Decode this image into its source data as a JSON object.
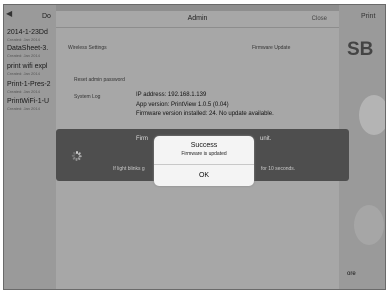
{
  "background": {
    "back_label": "",
    "doc_header": "Do",
    "documents": [
      {
        "name": "2014-1-23Dd",
        "sub": "Created: Jan 2014"
      },
      {
        "name": "DataSheet-3.",
        "sub": "Created: Jan 2014"
      },
      {
        "name": "print wifi expl",
        "sub": "Created: Jan 2014"
      },
      {
        "name": "Print-1-Pres-2",
        "sub": "Created: Jan 2014"
      },
      {
        "name": "PrintWiFi-1-U",
        "sub": "Created: Jan 2014"
      }
    ],
    "print_label": "Print",
    "right_big_text": "SB",
    "more_label": "ore"
  },
  "admin": {
    "title": "Admin",
    "close_label": "Close",
    "wireless_settings": "Wireless Settings",
    "firmware_update": "Firmware Update",
    "reset_admin_password": "Reset admin password",
    "system_log": "System Log",
    "ip_address": "IP address: 192.168.1.139",
    "app_version": "App version: PrintView 1.0.5 (0.04)",
    "firmware_installed": "Firmware version installed: 24.  No update available."
  },
  "progress": {
    "msg_left": "Firm",
    "msg_right": "unit.",
    "hint_left": "If light blinks g",
    "hint_right": "for 10 seconds."
  },
  "alert": {
    "title": "Success",
    "message": "Firmware is updated",
    "ok_label": "OK"
  }
}
